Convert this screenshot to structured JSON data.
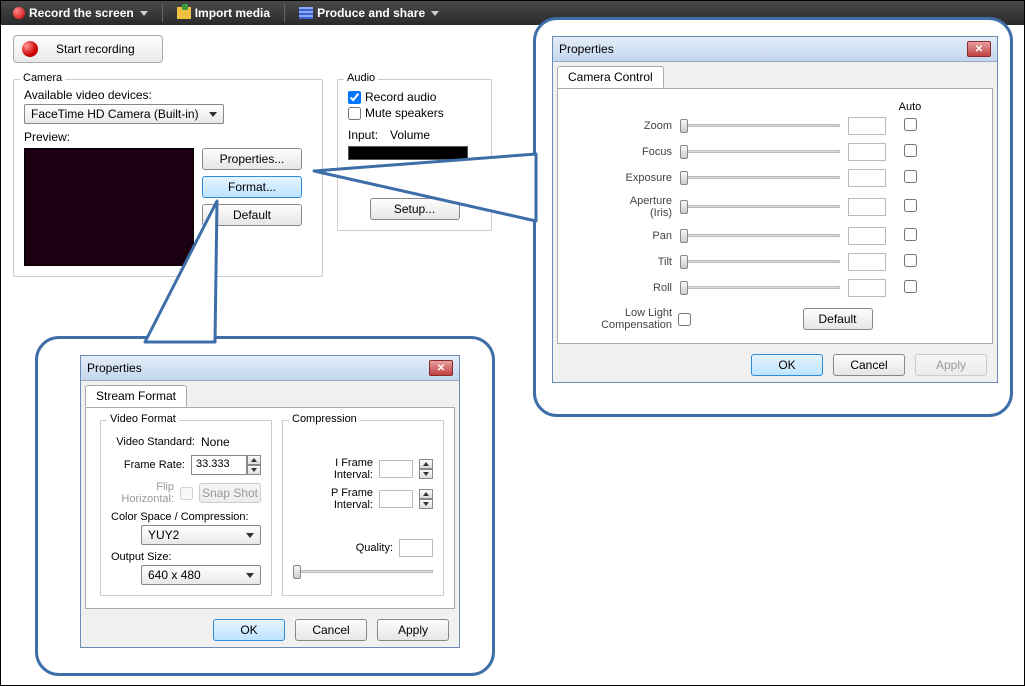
{
  "toolbar": {
    "record_label": "Record the screen",
    "import_label": "Import media",
    "produce_label": "Produce and share"
  },
  "start_recording_label": "Start recording",
  "camera": {
    "title": "Camera",
    "available_label": "Available video devices:",
    "device": "FaceTime HD Camera (Built-in)",
    "preview_label": "Preview:",
    "properties_btn": "Properties...",
    "format_btn": "Format...",
    "default_btn": "Default"
  },
  "audio": {
    "title": "Audio",
    "record_audio": "Record audio",
    "mute_speakers": "Mute speakers",
    "input_label": "Input:",
    "volume_label": "Volume",
    "setup_btn": "Setup..."
  },
  "cam_props": {
    "title": "Properties",
    "tab": "Camera Control",
    "auto_header": "Auto",
    "rows": [
      "Zoom",
      "Focus",
      "Exposure",
      "Aperture\n(Iris)",
      "Pan",
      "Tilt",
      "Roll"
    ],
    "low_light": "Low Light\nCompensation",
    "default_btn": "Default",
    "ok": "OK",
    "cancel": "Cancel",
    "apply": "Apply"
  },
  "stream_props": {
    "title": "Properties",
    "tab": "Stream Format",
    "video_format_legend": "Video Format",
    "compression_legend": "Compression",
    "video_standard_label": "Video Standard:",
    "video_standard_value": "None",
    "frame_rate_label": "Frame Rate:",
    "frame_rate_value": "33.333",
    "flip_label": "Flip Horizontal:",
    "snapshot_btn": "Snap Shot",
    "colorspace_label": "Color Space / Compression:",
    "colorspace_value": "YUY2",
    "output_size_label": "Output Size:",
    "output_size_value": "640 x 480",
    "iframe_label": "I Frame Interval:",
    "pframe_label": "P Frame Interval:",
    "quality_label": "Quality:",
    "ok": "OK",
    "cancel": "Cancel",
    "apply": "Apply"
  }
}
